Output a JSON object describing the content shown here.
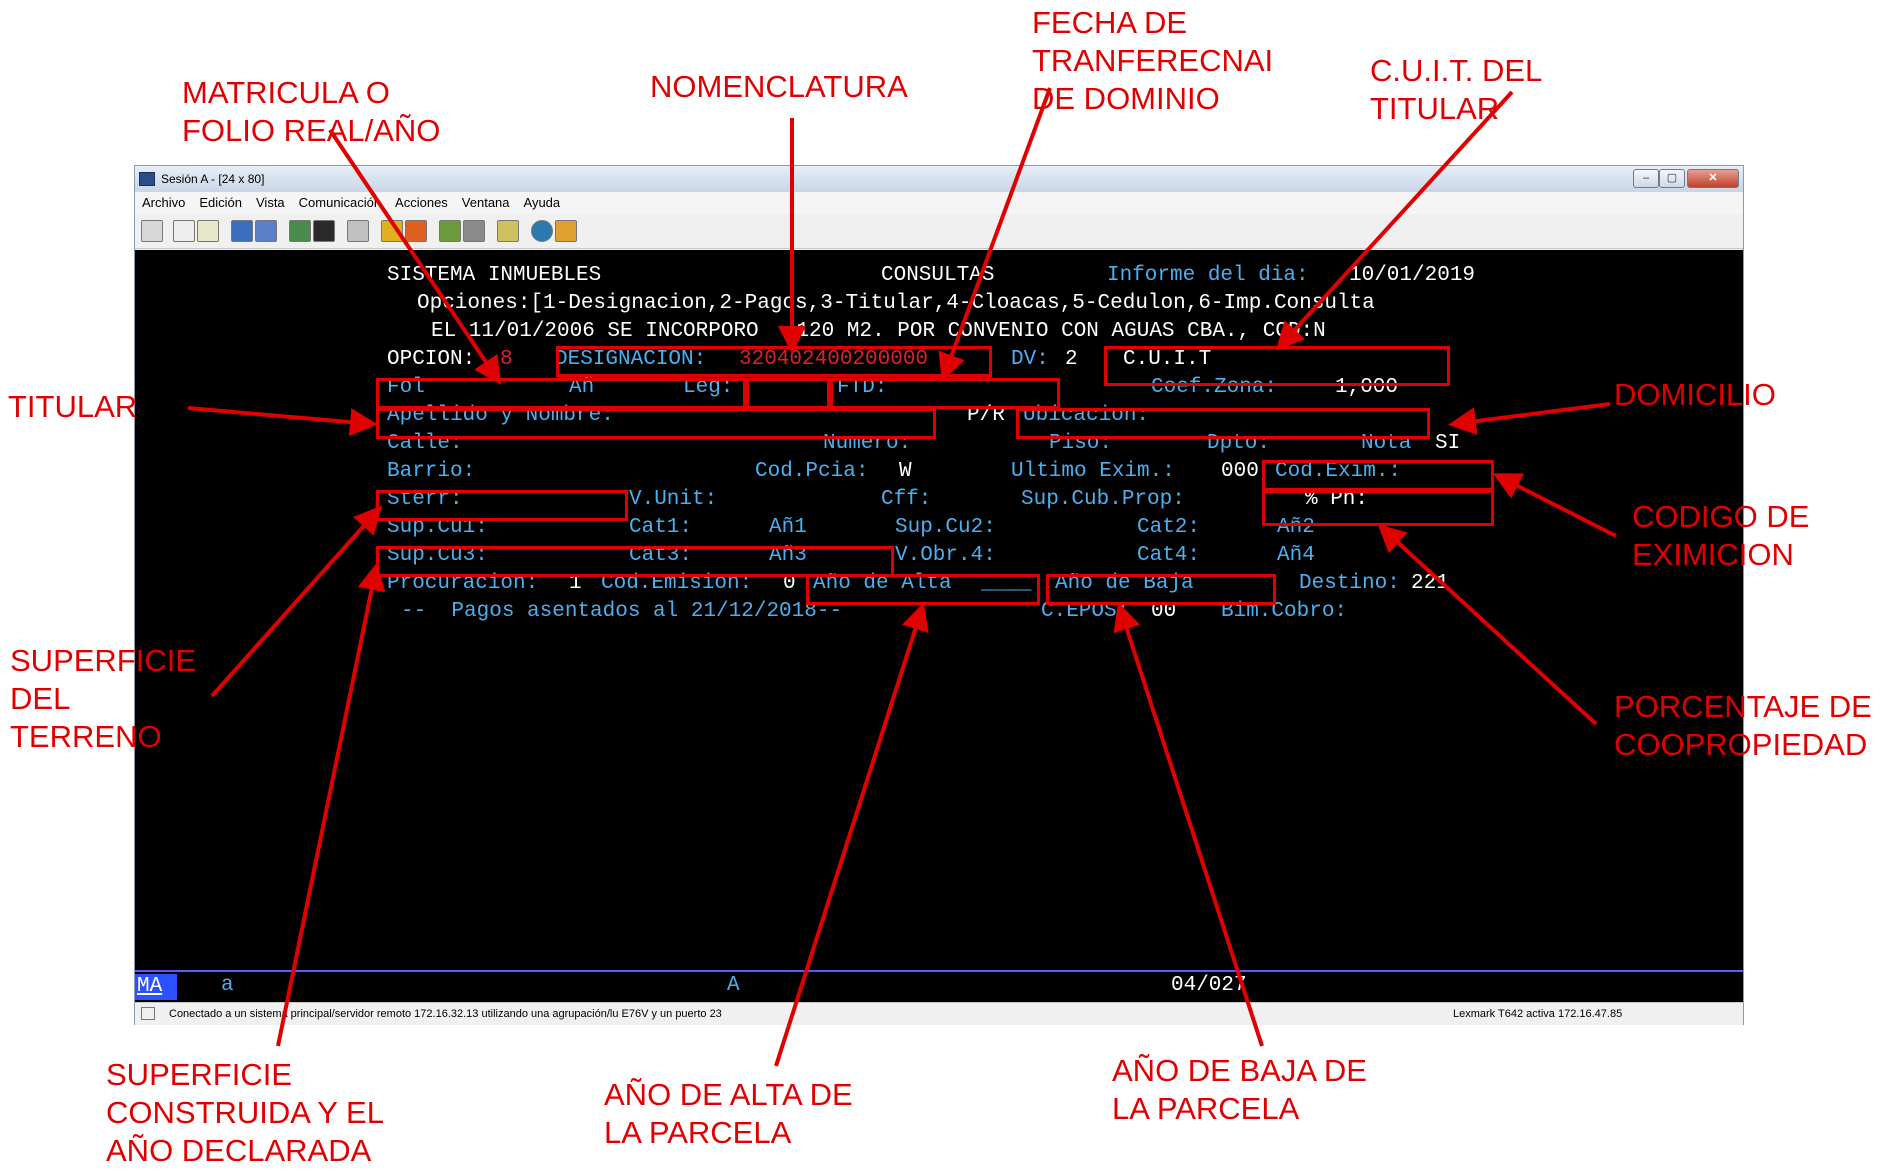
{
  "window": {
    "title": "Sesión A - [24 x 80]",
    "controls": {
      "minimize": "–",
      "maximize": "▢",
      "close": "✕"
    },
    "menu": [
      "Archivo",
      "Edición",
      "Vista",
      "Comunicación",
      "Acciones",
      "Ventana",
      "Ayuda"
    ]
  },
  "terminal": {
    "l1": {
      "a": "SISTEMA INMUEBLES",
      "b": "CONSULTAS",
      "c": "Informe del dia:",
      "d": "10/01/2019"
    },
    "l2": "Opciones:[1-Designacion,2-Pagos,3-Titular,4-Cloacas,5-Cedulon,6-Imp.Consulta",
    "l3": "EL 11/01/2006 SE INCORPORO   120 M2. POR CONVENIO CON AGUAS CBA., COD:N",
    "l4": {
      "opcion": "OPCION:",
      "opcion_v": "8",
      "designacion": "DESIGNACION:",
      "designacion_v": "320402400200000",
      "dv": "DV:",
      "dv_v": "2",
      "cuit": "C.U.I.T"
    },
    "l5": {
      "fol": "Fol",
      "an": "Añ",
      "leg": "Leg:",
      "ftd": "FTD:",
      "coef": "Coef.Zona:",
      "coef_v": "1,000"
    },
    "l6": {
      "apellido": "Apellido y Nombre:",
      "pr": "P/R",
      "ubicacion": "Ubicacion:"
    },
    "l7": {
      "calle": "Calle:",
      "numero": "Numero:",
      "piso": "Piso:",
      "dpto": "Dpto:",
      "nota": "Nota",
      "nota_v": "SI"
    },
    "l8": {
      "barrio": "Barrio:",
      "codpcia": "Cod.Pcia:",
      "codpcia_v": "W",
      "ultimo": "Ultimo Exim.:",
      "ultimo_v": "000",
      "codexim": "Cod.Exim.:"
    },
    "l9": {
      "sterr": "Sterr:",
      "vunit": "V.Unit:",
      "cff": "Cff:",
      "supcub": "Sup.Cub.Prop:",
      "ph": "% Ph:"
    },
    "l10": {
      "supcu1": "Sup.Cu1:",
      "cat1": "Cat1:",
      "an1": "Añ1",
      "supcu2": "Sup.Cu2:",
      "cat2": "Cat2:",
      "an2": "Añ2"
    },
    "l11": {
      "supcu3": "Sup.Cu3:",
      "cat3": "Cat3:",
      "an3": "Añ3",
      "vobr4": "V.Obr.4:",
      "cat4": "Cat4:",
      "an4": "Añ4"
    },
    "l12": {
      "procuracion": "Procuracion:",
      "procuracion_v": "1",
      "codemision": "Cod.Emision:",
      "codemision_v": "0",
      "anoalta": "Año de Alta",
      "anoalta_blank": "____",
      "anobaja": "Año de Baja",
      "destino": "Destino:",
      "destino_v": "221"
    },
    "l13": {
      "pagos": "--  Pagos asentados al 21/12/2018--",
      "cepos": "C.EPOS:",
      "cepos_v": "00",
      "bimcobro": "Bim.Cobro:"
    },
    "oia": {
      "ma": "MA",
      "a1": "a",
      "a2": "A",
      "pos": "04/027"
    }
  },
  "statusbar": {
    "left": "Conectado a un sistema principal/servidor remoto 172.16.32.13 utilizando una agrupación/lu E76V y un puerto 23",
    "right": "Lexmark T642 activa 172.16.47.85"
  },
  "annotations": {
    "matricula": "MATRICULA O\nFOLIO REAL/AÑO",
    "nomenclatura": "NOMENCLATURA",
    "fecha": "FECHA DE\nTRANFERECNAI\nDE DOMINIO",
    "cuit": "C.U.I.T. DEL\nTITULAR",
    "titular": "TITULAR",
    "domicilio": "DOMICILIO",
    "codigo": "CODIGO DE\nEXIMICION",
    "superficie_terreno": "SUPERFICIE\nDEL\nTERRENO",
    "porcentaje": "PORCENTAJE DE\nCOOPROPIEDAD",
    "superficie_construida": "SUPERFICIE\nCONSTRUIDA Y EL\nAÑO DECLARADA",
    "ano_alta": "AÑO DE ALTA DE\nLA PARCELA",
    "ano_baja": "AÑO DE BAJA DE\nLA PARCELA"
  },
  "colors": {
    "annotation": "#e00000",
    "terminal_bg": "#000000",
    "field_label": "#4ab0f0",
    "highlight_value": "#e02020"
  }
}
